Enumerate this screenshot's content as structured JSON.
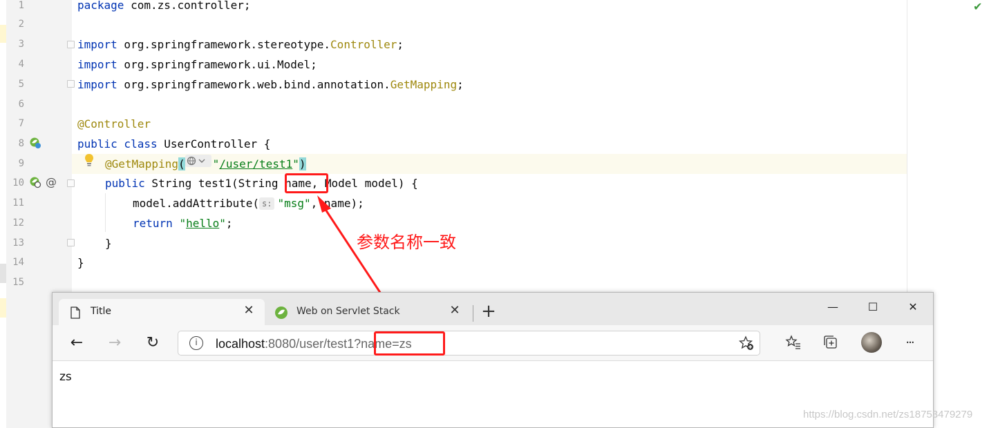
{
  "editor": {
    "line_numbers": [
      "1",
      "2",
      "3",
      "4",
      "5",
      "6",
      "7",
      "8",
      "9",
      "10",
      "11",
      "12",
      "13",
      "14",
      "15"
    ],
    "code": {
      "l1_kw": "package",
      "l1_rest": " com.zs.controller;",
      "l3_kw": "import",
      "l3_rest": " org.springframework.stereotype.",
      "l3_cls": "Controller",
      "l3_end": ";",
      "l4_kw": "import",
      "l4_rest": " org.springframework.ui.Model;",
      "l5_kw": "import",
      "l5_rest": " org.springframework.web.bind.annotation.",
      "l5_cls": "GetMapping",
      "l5_end": ";",
      "l7_ann": "@Controller",
      "l8_kw": "public class",
      "l8_rest": " UserController {",
      "l9_ann": "@GetMapping",
      "l9_paren_open": "(",
      "l9_str_q1": "\"",
      "l9_str": "/user/test1",
      "l9_str_q2": "\"",
      "l9_paren_close": ")",
      "l10_kw": "public",
      "l10_rest1": " String test1(String ",
      "l10_param": "name",
      "l10_rest2": ", Model model) {",
      "l11_call": "model.addAttribute(",
      "l11_hint": "s:",
      "l11_str": "\"msg\"",
      "l11_rest": ", name);",
      "l12_kw": "return",
      "l12_sp": " ",
      "l12_q1": "\"",
      "l12_str": "hello",
      "l12_q2": "\"",
      "l12_end": ";",
      "l13": "}",
      "l14": "}"
    },
    "check_glyph": "✔"
  },
  "annotation": {
    "note": "参数名称一致",
    "color": "#ff1a1a"
  },
  "browser": {
    "tabs": [
      {
        "title": "Title",
        "close": "✕"
      },
      {
        "title": "Web on Servlet Stack",
        "close": "✕"
      }
    ],
    "new_tab": "+",
    "window_controls": {
      "minimize": "—",
      "maximize": "☐",
      "close": "✕"
    },
    "nav": {
      "back": "←",
      "forward": "→",
      "reload": "↻"
    },
    "address": {
      "host": "localhost",
      "rest": ":8080/user/test1?name=zs"
    },
    "toolbar_icons": [
      "favorites-star-icon",
      "favorites-list-icon",
      "collections-icon",
      "profile-avatar",
      "more-menu-icon"
    ],
    "more_label": "···",
    "page_text": "zs"
  },
  "watermark": "https://blog.csdn.net/zs18753479279"
}
